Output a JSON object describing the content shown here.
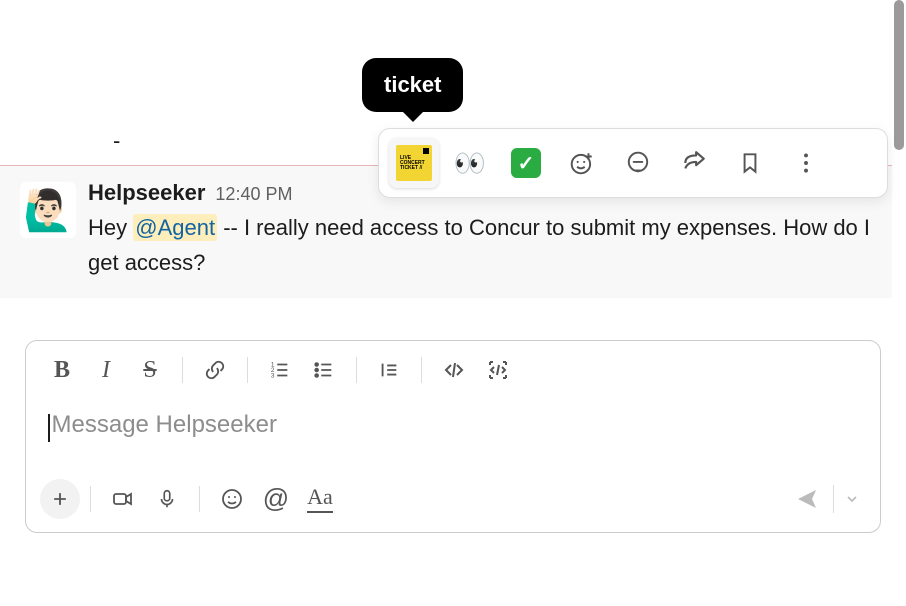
{
  "message": {
    "sender": "Helpseeker",
    "time": "12:40 PM",
    "avatar_emoji": "🙋🏻‍♂️",
    "text_prefix": "Hey ",
    "mention": "@Agent",
    "text_suffix": " -- I really need access to Concur to submit my expenses. How do I get access?"
  },
  "tooltip": {
    "label": "ticket"
  },
  "reaction_bar": {
    "items": [
      {
        "name": "ticket",
        "type": "ticket"
      },
      {
        "name": "eyes",
        "type": "emoji",
        "glyph": "👀"
      },
      {
        "name": "white_check_mark",
        "type": "check"
      },
      {
        "name": "add-reaction",
        "type": "icon"
      },
      {
        "name": "thread",
        "type": "icon"
      },
      {
        "name": "share",
        "type": "icon"
      },
      {
        "name": "bookmark",
        "type": "icon"
      },
      {
        "name": "more",
        "type": "icon"
      }
    ]
  },
  "composer": {
    "placeholder": "Message Helpseeker",
    "top_toolbar": [
      "bold",
      "italic",
      "strike",
      "sep",
      "link",
      "sep",
      "ordered-list",
      "bullet-list",
      "sep",
      "blockquote",
      "sep",
      "code",
      "code-block"
    ],
    "bottom_toolbar": [
      "plus",
      "sep",
      "video",
      "audio",
      "sep",
      "emoji",
      "mention",
      "format"
    ],
    "send": {
      "enabled": false
    }
  },
  "misc": {
    "dash": "-"
  }
}
